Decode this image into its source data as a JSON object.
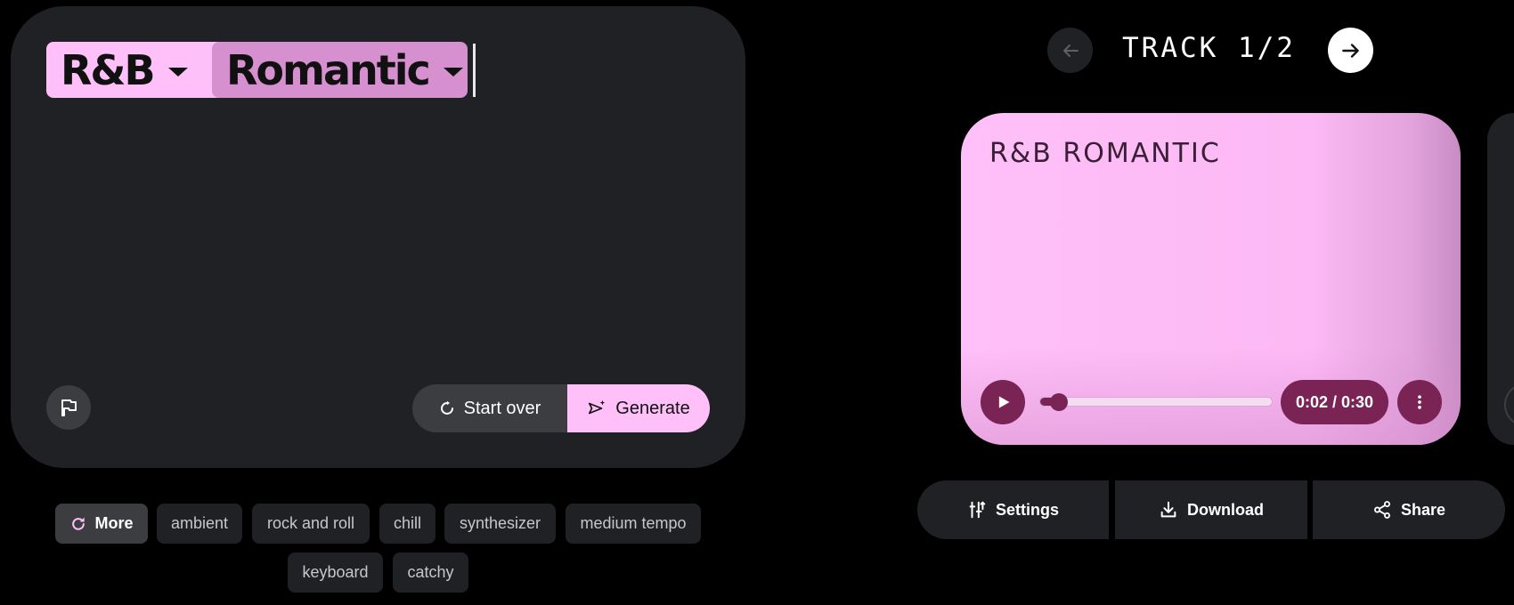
{
  "prompt": {
    "genre_chip": "R&B",
    "mood_chip": "Romantic",
    "start_over_label": "Start over",
    "generate_label": "Generate"
  },
  "suggestions": {
    "more_label": "More",
    "chips": [
      "ambient",
      "rock and roll",
      "chill",
      "synthesizer",
      "medium tempo",
      "keyboard",
      "catchy"
    ]
  },
  "track": {
    "counter": "TRACK 1/2",
    "title": "R&B ROMANTIC",
    "time": "0:02 / 0:30",
    "progress_fraction": 0.067
  },
  "actions": {
    "settings_label": "Settings",
    "download_label": "Download",
    "share_label": "Share"
  },
  "colors": {
    "accent_pink": "#ffbff8",
    "accent_mauve": "#d690cf",
    "player_control": "#7a2456",
    "panel": "#202124"
  },
  "icons": [
    "chevron-down-icon",
    "flag-icon",
    "refresh-icon",
    "sparkle-send-icon",
    "arrow-left-icon",
    "arrow-right-icon",
    "play-icon",
    "more-vert-icon",
    "tune-icon",
    "download-icon",
    "share-icon"
  ]
}
